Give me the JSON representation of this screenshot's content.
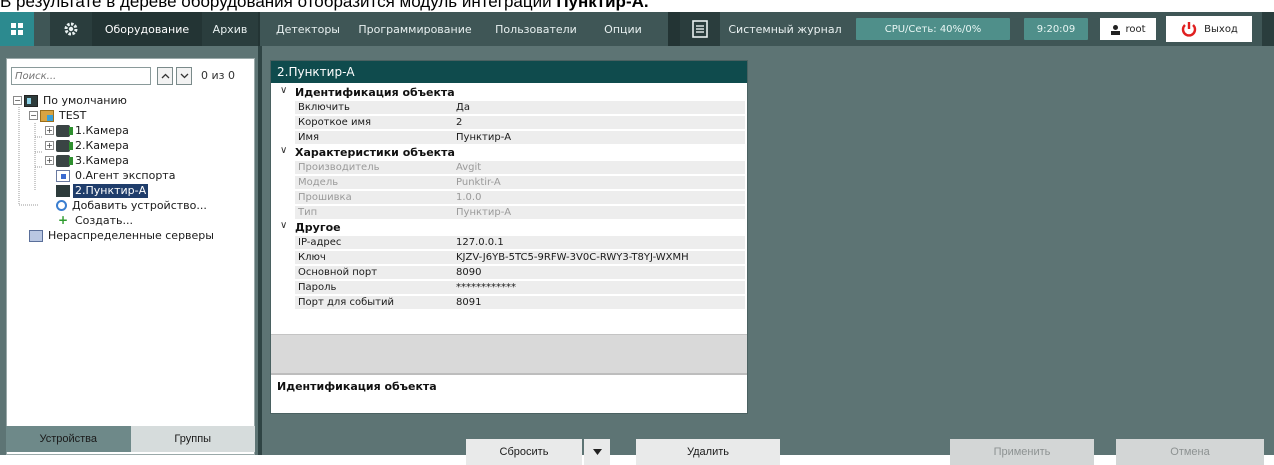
{
  "doc_caption": {
    "text": "В результате в дереве оборудования отобразится модуль интеграции ",
    "bold": "Пунктир-А."
  },
  "topbar": {
    "home_icon": "grid-home-icon",
    "settings_icon": "gear-icon",
    "tabs": [
      {
        "label": "Оборудование"
      },
      {
        "label": "Архив"
      },
      {
        "label": "Детекторы"
      },
      {
        "label": "Программирование"
      },
      {
        "label": "Пользователи"
      },
      {
        "label": "Опции"
      }
    ],
    "journal_icon": "journal-icon",
    "journal_label": "Системный журнал",
    "cpu_label": "CPU/Сеть: 40%/0%",
    "time": "9:20:09",
    "user_icon": "user-icon",
    "user": "root",
    "exit_icon": "power-icon",
    "exit_label": "Выход"
  },
  "colors": {
    "accent": "#0f4b4d",
    "topbar": "#3f5656",
    "background": "#5d7474",
    "selection": "#1f3d6b"
  },
  "search": {
    "placeholder": "Поиск...",
    "up_icon": "chevron-up-icon",
    "down_icon": "chevron-down-icon",
    "count": "0 из 0"
  },
  "tree": [
    {
      "label": "По умолчанию",
      "icon": "server-icon",
      "toggle": "−"
    },
    {
      "label": "TEST",
      "icon": "folder-icon",
      "toggle": "−"
    },
    {
      "label": "1.Камера",
      "icon": "camera-icon",
      "toggle": "+"
    },
    {
      "label": "2.Камера",
      "icon": "camera-icon",
      "toggle": "+"
    },
    {
      "label": "3.Камера",
      "icon": "camera-icon",
      "toggle": "+"
    },
    {
      "label": "0.Агент экспорта",
      "icon": "export-agent-icon",
      "toggle": ""
    },
    {
      "label": "2.Пунктир-А",
      "icon": "punktir-device-icon",
      "toggle": "",
      "selected": true
    },
    {
      "label": "Добавить устройство...",
      "icon": "search-add-icon",
      "toggle": ""
    },
    {
      "label": "Создать...",
      "icon": "create-icon",
      "toggle": ""
    },
    {
      "label": "Нераспределенные серверы",
      "icon": "unassigned-servers-icon",
      "toggle": ""
    }
  ],
  "left_tabs": [
    {
      "label": "Устройства",
      "active": true
    },
    {
      "label": "Группы",
      "active": false
    }
  ],
  "props": {
    "title": "2.Пунктир-А",
    "sections": [
      {
        "title": "Идентификация объекта",
        "rows": [
          {
            "k": "Включить",
            "v": "Да",
            "disabled": false
          },
          {
            "k": "Короткое имя",
            "v": "2",
            "disabled": false
          },
          {
            "k": "Имя",
            "v": "Пунктир-А",
            "disabled": false
          }
        ]
      },
      {
        "title": "Характеристики объекта",
        "rows": [
          {
            "k": "Производитель",
            "v": "Avgit",
            "disabled": true
          },
          {
            "k": "Модель",
            "v": "Punktir-A",
            "disabled": true
          },
          {
            "k": "Прошивка",
            "v": "1.0.0",
            "disabled": true
          },
          {
            "k": "Тип",
            "v": "Пунктир-А",
            "disabled": true
          }
        ]
      },
      {
        "title": "Другое",
        "rows": [
          {
            "k": "IP-адрес",
            "v": "127.0.0.1",
            "disabled": false
          },
          {
            "k": "Ключ",
            "v": "KJZV-J6YB-5TC5-9RFW-3V0C-RWY3-T8YJ-WXMH",
            "disabled": false
          },
          {
            "k": "Основной порт",
            "v": "8090",
            "disabled": false
          },
          {
            "k": "Пароль",
            "v": "************",
            "disabled": false
          },
          {
            "k": "Порт для событий",
            "v": "8091",
            "disabled": false
          }
        ]
      }
    ],
    "description_title": "Идентификация объекта"
  },
  "buttons": {
    "reset": "Сбросить",
    "reset_menu_icon": "caret-down-icon",
    "delete": "Удалить",
    "apply": "Применить",
    "cancel": "Отмена"
  }
}
